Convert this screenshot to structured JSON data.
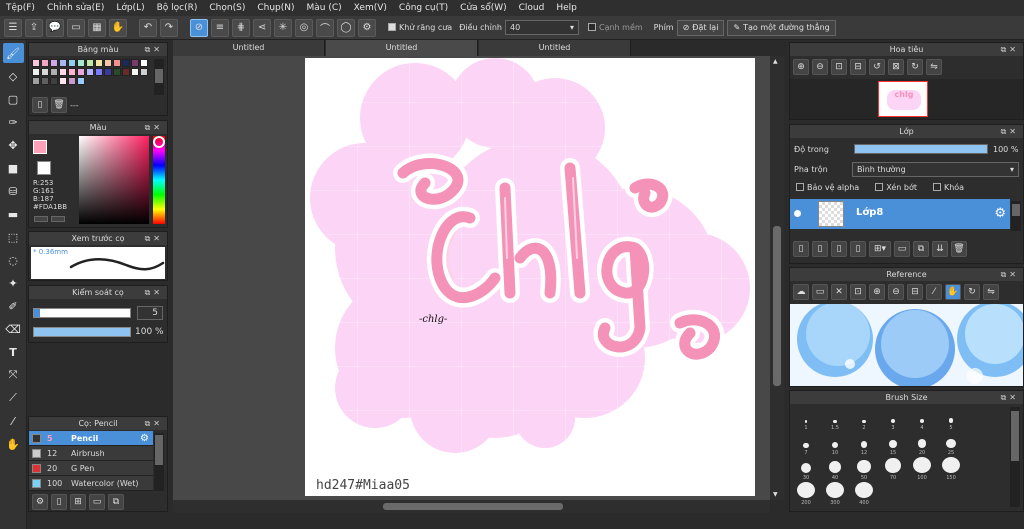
{
  "menu": [
    "Tệp(F)",
    "Chỉnh sửa(E)",
    "Lớp(L)",
    "Bộ lọc(R)",
    "Chọn(S)",
    "Chụp(N)",
    "Màu (C)",
    "Xem(V)",
    "Công cụ(T)",
    "Cửa sổ(W)",
    "Cloud",
    "Help"
  ],
  "toolbar": {
    "antialias_label": "Khử răng cưa",
    "adjust_label": "Điều chỉnh",
    "adjust_value": "40",
    "smooth_label": "Cạnh mềm",
    "key_label": "Phím",
    "reset_label": "Đặt lại",
    "line_label": "Tạo một đường thẳng"
  },
  "palette": {
    "title": "Bảng màu",
    "name": "---",
    "swatches": [
      "#f7c7d9",
      "#f2a6c4",
      "#cfa6e8",
      "#a6b8f2",
      "#8fd0f0",
      "#a6e8d0",
      "#c0e8a6",
      "#f2e6a6",
      "#f2c6a6",
      "#f28f8f",
      "#1a2a5a",
      "#7a3a6a",
      "#ffffff",
      "#f0f0f0",
      "#d8d8d8",
      "#b0b0b0",
      "#ffd9e6",
      "#ffb3cc",
      "#e8a6d9",
      "#b3b3ff",
      "#7a7aff",
      "#3a3a9a",
      "#2a4a2a",
      "#6a2a2a",
      "#f5f5f5",
      "#d0d0d0",
      "#a0a0a0",
      "#606060",
      "#404040",
      "#ffe6f0",
      "#cc99cc",
      "#99ccff"
    ]
  },
  "color": {
    "title": "Màu",
    "r": "R:253",
    "g": "G:161",
    "b": "B:187",
    "hex": "#FDA1BB",
    "fg": "#fda1bb"
  },
  "brush_preview": {
    "title": "Xem trước cọ",
    "size": "* 0.36mm"
  },
  "brush_control": {
    "title": "Kiểm soát cọ",
    "size": "5",
    "opacity": "100 %"
  },
  "brush_list": {
    "title": "Cọ: Pencil",
    "items": [
      {
        "size": "5",
        "name": "Pencil",
        "color": "#333333"
      },
      {
        "size": "12",
        "name": "Airbrush",
        "color": "#cccccc"
      },
      {
        "size": "20",
        "name": "G Pen",
        "color": "#e03030"
      },
      {
        "size": "100",
        "name": "Watercolor (Wet)",
        "color": "#7ad0f5"
      }
    ]
  },
  "tabs": [
    "Untitled",
    "Untitled",
    "Untitled"
  ],
  "canvas": {
    "title_text": "chlg",
    "small_text": "-chlg-",
    "watermark": "hd247#Miaa05"
  },
  "navigator": {
    "title": "Hoa tiêu"
  },
  "layer": {
    "title": "Lớp",
    "opacity_label": "Độ trong",
    "opacity_value": "100 %",
    "opacity_fraction": 1.0,
    "blend_label": "Pha trộn",
    "blend_value": "Bình thường",
    "protect_alpha": "Bảo vệ alpha",
    "clip": "Xén bớt",
    "lock": "Khóa",
    "layer_name": "Lớp8"
  },
  "reference": {
    "title": "Reference"
  },
  "brush_size": {
    "title": "Brush Size",
    "sizes": [
      "1",
      "1.5",
      "2",
      "3",
      "4",
      "5",
      "7",
      "10",
      "12",
      "15",
      "20",
      "25",
      "30",
      "40",
      "50",
      "70",
      "100",
      "150",
      "200",
      "300",
      "400"
    ]
  },
  "colors": {
    "accent": "#4a90d9",
    "pink": "#f7a1c4",
    "blob": "#fcd4f5"
  }
}
